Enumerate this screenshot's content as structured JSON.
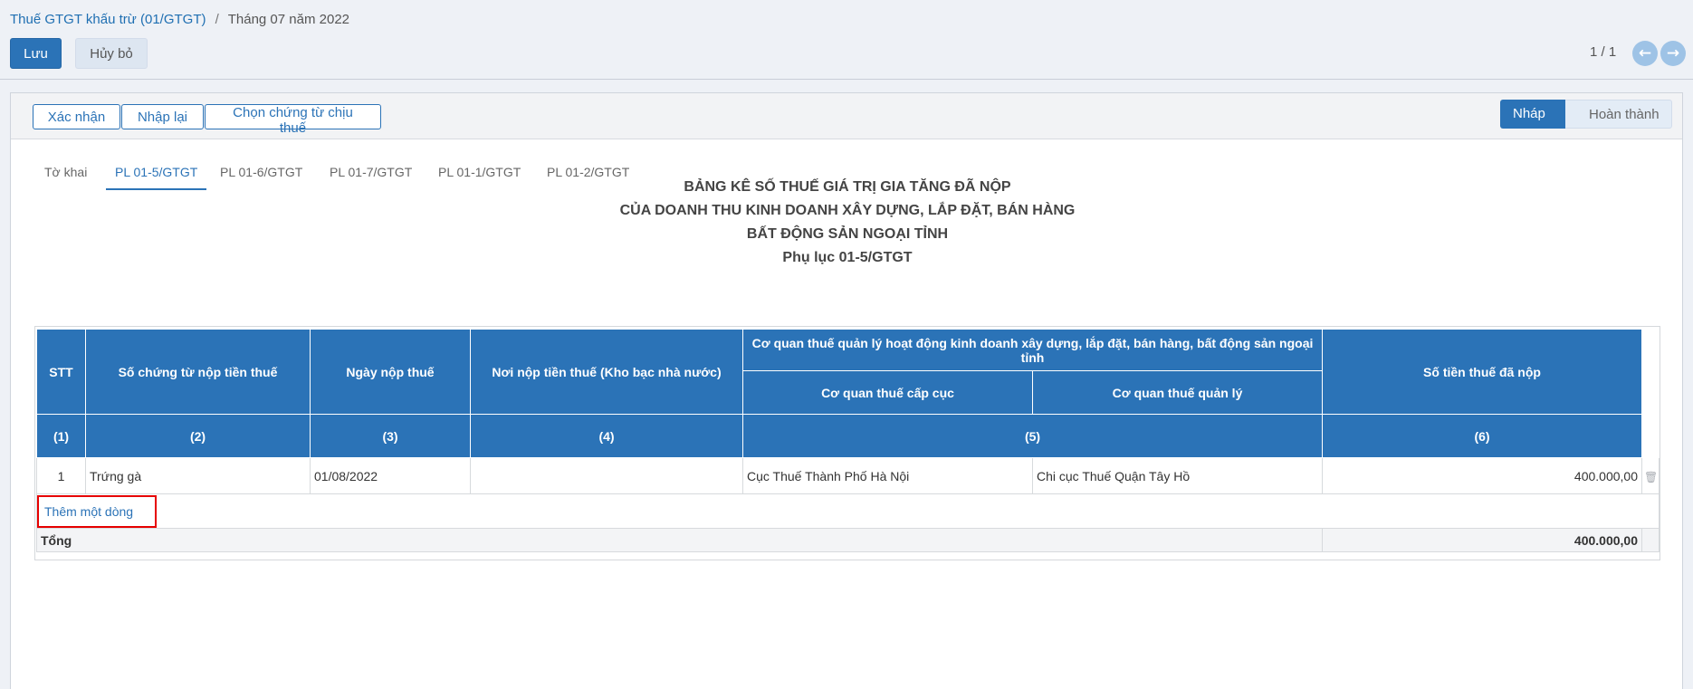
{
  "breadcrumb": {
    "parent": "Thuế GTGT khấu trừ (01/GTGT)",
    "separator": "/",
    "current": "Tháng 07 năm 2022"
  },
  "actions": {
    "save": "Lưu",
    "discard": "Hủy bỏ"
  },
  "pager": {
    "value": "1 / 1",
    "prev_icon": "←",
    "next_icon": "→"
  },
  "statusbar": {
    "buttons": [
      "Xác nhận",
      "Nhập lại",
      "Chọn chứng từ chịu thuế"
    ],
    "stages": [
      "Nháp",
      "Hoàn thành"
    ],
    "active_stage": "Nháp"
  },
  "tabs": [
    "Tờ khai",
    "PL 01-5/GTGT",
    "PL 01-6/GTGT",
    "PL 01-7/GTGT",
    "PL 01-1/GTGT",
    "PL 01-2/GTGT"
  ],
  "active_tab": "PL 01-5/GTGT",
  "title_lines": [
    "BẢNG KÊ SỐ THUẾ GIÁ TRỊ GIA TĂNG ĐÃ NỘP",
    "CỦA DOANH THU KINH DOANH XÂY DỰNG, LẮP ĐẶT, BÁN HÀNG",
    "BẤT ĐỘNG SẢN NGOẠI TỈNH",
    "Phụ lục 01-5/GTGT"
  ],
  "table": {
    "headers": {
      "stt": "STT",
      "document_no": "Số chứng từ nộp tiền thuế",
      "payment_date": "Ngày nộp thuế",
      "payment_place": "Nơi nộp tiền thuế (Kho bạc nhà nước)",
      "authority_group": "Cơ quan thuế quản lý hoạt động kinh doanh xây dựng, lắp đặt, bán hàng, bất động sản ngoại tỉnh",
      "authority_department": "Cơ quan thuế cấp cục",
      "authority_manager": "Cơ quan thuế quản lý",
      "amount": "Số tiền thuế đã nộp"
    },
    "column_numbers": [
      "(1)",
      "(2)",
      "(3)",
      "(4)",
      "(5)",
      "(6)"
    ],
    "rows": [
      {
        "stt": "1",
        "document_no": "Trứng gà",
        "payment_date": "01/08/2022",
        "payment_place": "",
        "authority_department": "Cục Thuế Thành Phố Hà Nội",
        "authority_manager": "Chi cục Thuế Quận Tây Hồ",
        "amount": "400.000,00"
      }
    ],
    "add_line_label": "Thêm một dòng",
    "total_label": "Tổng",
    "total_amount": "400.000,00",
    "delete_icon": "🗑"
  },
  "colors": {
    "primary": "#2b73b7",
    "highlight_border": "#e60000",
    "control_panel_bg": "#eef1f6"
  }
}
